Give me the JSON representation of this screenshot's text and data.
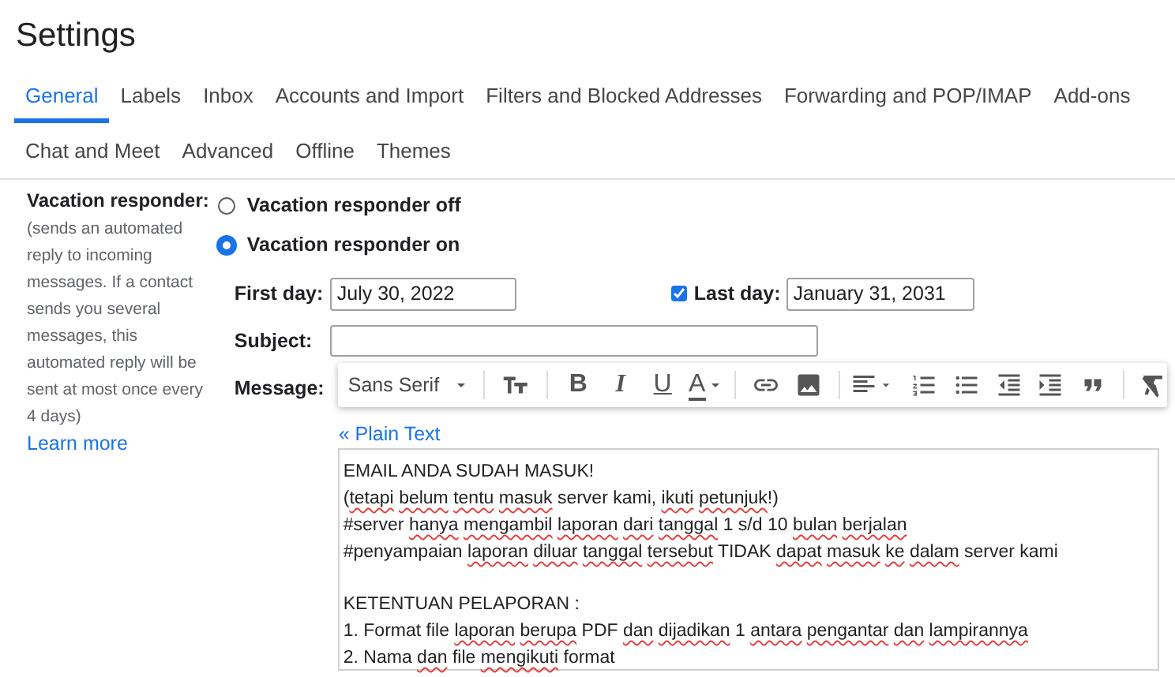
{
  "title": "Settings",
  "tabs": [
    {
      "label": "General",
      "selected": true
    },
    {
      "label": "Labels",
      "selected": false
    },
    {
      "label": "Inbox",
      "selected": false
    },
    {
      "label": "Accounts and Import",
      "selected": false
    },
    {
      "label": "Filters and Blocked Addresses",
      "selected": false
    },
    {
      "label": "Forwarding and POP/IMAP",
      "selected": false
    },
    {
      "label": "Add-ons",
      "selected": false
    },
    {
      "label": "Chat and Meet",
      "selected": false
    },
    {
      "label": "Advanced",
      "selected": false
    },
    {
      "label": "Offline",
      "selected": false
    },
    {
      "label": "Themes",
      "selected": false
    }
  ],
  "vacation": {
    "heading": "Vacation responder:",
    "description": "(sends an automated reply to incoming messages. If a contact sends you several messages, this automated reply will be sent at most once every 4 days)",
    "learn_more": "Learn more",
    "options": [
      {
        "label": "Vacation responder off",
        "selected": false
      },
      {
        "label": "Vacation responder on",
        "selected": true
      }
    ],
    "first_day": {
      "label": "First day:",
      "value": "July 30, 2022"
    },
    "last_day": {
      "label": "Last day:",
      "value": "January 31, 2031",
      "checked": true
    },
    "subject": {
      "label": "Subject:"
    },
    "message": {
      "label": "Message:",
      "plain_text_link": "« Plain Text",
      "toolbar": {
        "font_menu": "Sans Serif",
        "bold": "B",
        "italic": "I",
        "underline": "U",
        "text_color": "A"
      },
      "paragraphs": [
        [
          [
            {
              "text": "EMAIL ANDA SUDAH MASUK!",
              "misspelled": false
            }
          ],
          [
            {
              "prefix": "(",
              "text": "tetapi",
              "misspelled": true
            },
            {
              "text": "belum",
              "misspelled": true
            },
            {
              "text": "tentu",
              "misspelled": true
            },
            {
              "text": "masuk",
              "misspelled": true
            },
            {
              "text": "server kami,",
              "misspelled": false
            },
            {
              "text": "ikuti",
              "misspelled": true
            },
            {
              "text": "petunjuk",
              "suffix": "!)",
              "misspelled": true
            }
          ],
          [
            {
              "text": "#server",
              "misspelled": false
            },
            {
              "text": "hanya",
              "misspelled": true
            },
            {
              "text": "mengambil",
              "misspelled": true
            },
            {
              "text": "laporan",
              "misspelled": true
            },
            {
              "text": "dari",
              "misspelled": true
            },
            {
              "text": "tanggal",
              "misspelled": true
            },
            {
              "text": "1 s/d 10",
              "misspelled": false
            },
            {
              "text": "bulan",
              "misspelled": true
            },
            {
              "text": "berjalan",
              "misspelled": true
            }
          ],
          [
            {
              "text": "#penyampaian",
              "misspelled": false
            },
            {
              "text": "laporan",
              "misspelled": true
            },
            {
              "text": "diluar",
              "misspelled": true
            },
            {
              "text": "tanggal",
              "misspelled": true
            },
            {
              "text": "tersebut",
              "misspelled": true
            },
            {
              "text": "TIDAK",
              "misspelled": false
            },
            {
              "text": "dapat",
              "misspelled": true
            },
            {
              "text": "masuk",
              "misspelled": true
            },
            {
              "text": "ke",
              "misspelled": true
            },
            {
              "text": "dalam",
              "misspelled": true
            },
            {
              "text": "server kami",
              "misspelled": false
            }
          ]
        ],
        [
          [
            {
              "text": "KETENTUAN PELAPORAN :",
              "misspelled": false
            }
          ],
          [
            {
              "text": "1. Format file",
              "misspelled": false
            },
            {
              "text": "laporan",
              "misspelled": true
            },
            {
              "text": "berupa",
              "misspelled": true
            },
            {
              "text": "PDF",
              "misspelled": false
            },
            {
              "text": "dan",
              "misspelled": true
            },
            {
              "text": "dijadikan",
              "misspelled": true
            },
            {
              "text": "1",
              "misspelled": false
            },
            {
              "text": "antara",
              "misspelled": true
            },
            {
              "text": "pengantar",
              "misspelled": true
            },
            {
              "text": "dan",
              "misspelled": true
            },
            {
              "text": "lampirannya",
              "misspelled": true
            }
          ],
          [
            {
              "text": "2. Nama",
              "misspelled": false
            },
            {
              "text": "dan",
              "misspelled": true
            },
            {
              "text": "file",
              "misspelled": false
            },
            {
              "text": "mengikuti",
              "misspelled": true
            },
            {
              "text": "format",
              "misspelled": false
            }
          ]
        ]
      ]
    }
  }
}
